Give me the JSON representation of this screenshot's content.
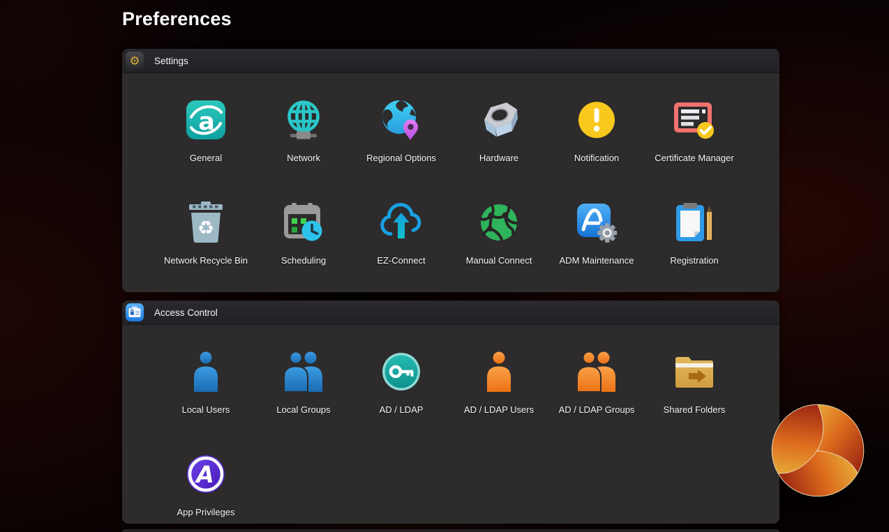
{
  "page": {
    "title": "Preferences"
  },
  "sections": [
    {
      "title": "Settings",
      "icon": "settings-gear-icon",
      "items": [
        {
          "label": "General",
          "icon": "asustor-general-icon"
        },
        {
          "label": "Network",
          "icon": "network-globe-icon"
        },
        {
          "label": "Regional Options",
          "icon": "globe-location-pin-icon"
        },
        {
          "label": "Hardware",
          "icon": "hardware-nut-icon"
        },
        {
          "label": "Notification",
          "icon": "notification-exclamation-icon"
        },
        {
          "label": "Certificate Manager",
          "icon": "certificate-check-icon"
        },
        {
          "label": "Network Recycle Bin",
          "icon": "recycle-bin-icon"
        },
        {
          "label": "Scheduling",
          "icon": "calendar-clock-icon"
        },
        {
          "label": "EZ-Connect",
          "icon": "cloud-upload-icon"
        },
        {
          "label": "Manual Connect",
          "icon": "network-sphere-icon"
        },
        {
          "label": "ADM Maintenance",
          "icon": "adm-gear-icon"
        },
        {
          "label": "Registration",
          "icon": "clipboard-pencil-icon"
        }
      ]
    },
    {
      "title": "Access Control",
      "icon": "id-badge-icon",
      "items": [
        {
          "label": "Local Users",
          "icon": "user-blue-icon"
        },
        {
          "label": "Local Groups",
          "icon": "users-blue-icon"
        },
        {
          "label": "AD / LDAP",
          "icon": "key-circle-icon"
        },
        {
          "label": "AD / LDAP Users",
          "icon": "user-orange-icon"
        },
        {
          "label": "AD / LDAP Groups",
          "icon": "users-orange-icon"
        },
        {
          "label": "Shared Folders",
          "icon": "shared-folder-icon"
        },
        {
          "label": "App Privileges",
          "icon": "app-privileges-icon"
        }
      ]
    }
  ],
  "colors": {
    "panel_bg": "#2d2b2c",
    "panel_header_bg": "#242227",
    "accent_teal": "#1fb3b0",
    "accent_cyan": "#2cc3ea",
    "accent_blue": "#2f8fd6",
    "accent_orange": "#f08a2e",
    "notification_yellow": "#f8c81c",
    "certificate_coral": "#f2726e",
    "app_purple": "#5a2fd0",
    "background_glow": "#3a0c07"
  },
  "watermark": {
    "name": "orange-swirl-logo"
  }
}
